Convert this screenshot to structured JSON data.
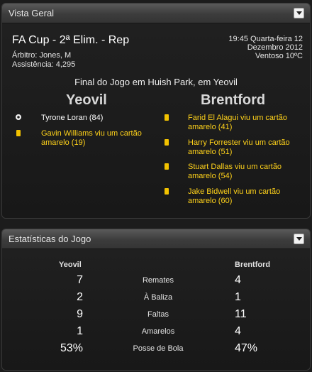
{
  "overview": {
    "title": "Vista Geral",
    "competition": "FA Cup - 2ª Elim. - Rep",
    "referee": "Árbitro: Jones, M",
    "attendance": "Assistência: 4,295",
    "datetime": "19:45 Quarta-feira 12",
    "date2": "Dezembro 2012",
    "weather": "Ventoso 10ºC",
    "final_text": "Final do Jogo em Huish Park, em Yeovil",
    "home_team": "Yeovil",
    "away_team": "Brentford",
    "home_events": [
      {
        "icon": "ball-icon",
        "text": "Tyrone Loran (84)",
        "color": "#ffffff"
      },
      {
        "icon": "yellow-card-icon",
        "text": "Gavin Williams viu um cartão amarelo (19)",
        "color": "#ffd21a"
      }
    ],
    "away_events": [
      {
        "icon": "yellow-card-icon",
        "text": "Farid El Alagui viu um cartão amarelo (41)",
        "color": "#ffd21a"
      },
      {
        "icon": "yellow-card-icon",
        "text": "Harry Forrester viu um cartão amarelo (51)",
        "color": "#ffd21a"
      },
      {
        "icon": "yellow-card-icon",
        "text": "Stuart Dallas viu um cartão amarelo (54)",
        "color": "#ffd21a"
      },
      {
        "icon": "yellow-card-icon",
        "text": "Jake Bidwell viu um cartão amarelo (60)",
        "color": "#ffd21a"
      }
    ]
  },
  "stats": {
    "title": "Estatísticas do Jogo",
    "home_team": "Yeovil",
    "away_team": "Brentford",
    "rows": [
      {
        "label": "Remates",
        "home": "7",
        "away": "4"
      },
      {
        "label": "À Baliza",
        "home": "2",
        "away": "1"
      },
      {
        "label": "Faltas",
        "home": "9",
        "away": "11"
      },
      {
        "label": "Amarelos",
        "home": "1",
        "away": "4"
      },
      {
        "label": "Posse de Bola",
        "home": "53%",
        "away": "47%"
      }
    ]
  }
}
